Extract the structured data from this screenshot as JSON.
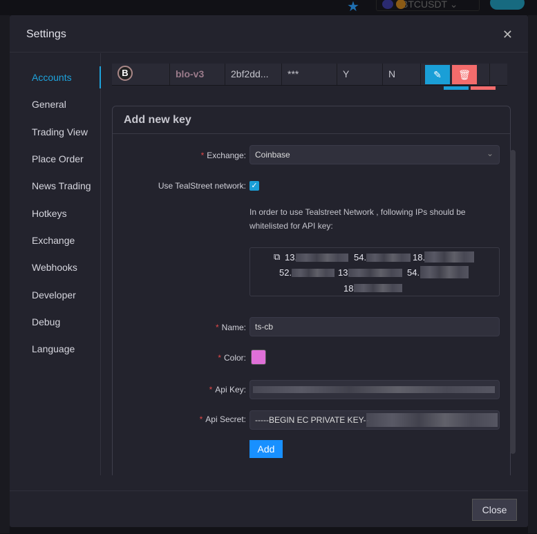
{
  "background": {
    "symbol": "BTCUSDT"
  },
  "modal": {
    "title": "Settings",
    "close_label": "Close"
  },
  "sidebar": {
    "items": [
      {
        "label": "Accounts",
        "active": true
      },
      {
        "label": "General"
      },
      {
        "label": "Trading View"
      },
      {
        "label": "Place Order"
      },
      {
        "label": "News Trading"
      },
      {
        "label": "Hotkeys"
      },
      {
        "label": "Exchange"
      },
      {
        "label": "Webhooks"
      },
      {
        "label": "Developer"
      },
      {
        "label": "Debug"
      },
      {
        "label": "Language"
      }
    ]
  },
  "accounts_table": {
    "row": {
      "name": "blo-v3",
      "key": "2bf2dd...",
      "secret": "***",
      "col4": "Y",
      "col5": "N"
    }
  },
  "form": {
    "title": "Add new key",
    "exchange_label": "Exchange:",
    "exchange_value": "Coinbase",
    "network_label": "Use TealStreet network:",
    "network_checked": true,
    "network_note": "In order to use Tealstreet Network , following IPs should be whitelisted for API key:",
    "ips": [
      "13.",
      "54.",
      "18.",
      "52.",
      "13.",
      "54.",
      "18."
    ],
    "name_label": "Name:",
    "name_value": "ts-cb",
    "color_label": "Color:",
    "color_value": "#df70d8",
    "api_key_label": "Api Key:",
    "api_secret_label": "Api Secret:",
    "api_secret_value": "-----BEGIN EC PRIVATE KEY--",
    "add_label": "Add"
  },
  "colors": {
    "accent": "#1ea3dc",
    "primary": "#1890ff",
    "danger": "#f36c6c"
  }
}
